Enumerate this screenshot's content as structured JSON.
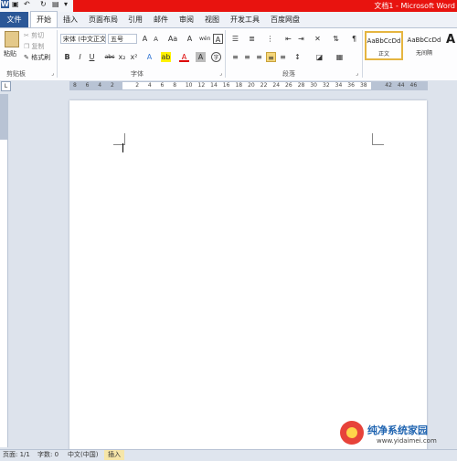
{
  "window": {
    "title": "文档1 - Microsoft Word",
    "colors": {
      "title_bar": "#e8130f",
      "file_tab": "#2b5797",
      "insert_mode": "#f6e6a8"
    }
  },
  "quick_access": [
    {
      "name": "word-logo-icon",
      "glyph": "W"
    },
    {
      "name": "save-icon",
      "glyph": "▣"
    },
    {
      "name": "undo-icon",
      "glyph": "↶"
    },
    {
      "name": "redo-icon",
      "glyph": "↻"
    },
    {
      "name": "print-preview-icon",
      "glyph": "▤"
    },
    {
      "name": "customize-icon",
      "glyph": "▾"
    }
  ],
  "tabs": [
    {
      "label": "文件"
    },
    {
      "label": "开始"
    },
    {
      "label": "插入"
    },
    {
      "label": "页面布局"
    },
    {
      "label": "引用"
    },
    {
      "label": "邮件"
    },
    {
      "label": "审阅"
    },
    {
      "label": "视图"
    },
    {
      "label": "开发工具"
    },
    {
      "label": "百度网盘"
    }
  ],
  "ribbon": {
    "clipboard": {
      "paste": "粘贴",
      "cut": "剪切",
      "copy": "复制",
      "format_painter": "格式刷",
      "group": "剪贴板"
    },
    "font": {
      "font_name": "宋体 (中文正文)",
      "font_size": "五号",
      "group": "字体",
      "grow": "A",
      "shrink": "A",
      "change_case": "Aa",
      "clear": "A",
      "wen": "wén",
      "char_border": "A",
      "bold": "B",
      "italic": "I",
      "underline": "U",
      "strike": "abc",
      "sub": "x₂",
      "sup": "x²",
      "effects": "A",
      "highlight": "ab",
      "font_color": "A",
      "shading": "A",
      "enclose": "字"
    },
    "paragraph": {
      "group": "段落"
    },
    "styles": [
      {
        "sample": "AaBbCcDd",
        "name": "正文"
      },
      {
        "sample": "AaBbCcDd",
        "name": "无间隔"
      },
      {
        "sample": "A",
        "name": ""
      }
    ]
  },
  "ruler": {
    "corner": "L",
    "ticks": [
      "8",
      "6",
      "4",
      "2",
      "",
      "2",
      "4",
      "6",
      "8",
      "10",
      "12",
      "14",
      "16",
      "18",
      "20",
      "22",
      "24",
      "26",
      "28",
      "30",
      "32",
      "34",
      "36",
      "38",
      "",
      "42",
      "44",
      "46"
    ]
  },
  "status": {
    "page": "页面: 1/1",
    "words": "字数: 0",
    "lang": "中文(中国)",
    "mode": "插入"
  },
  "watermark": {
    "title": "纯净系统家园",
    "url": "www.yidaimei.com"
  }
}
